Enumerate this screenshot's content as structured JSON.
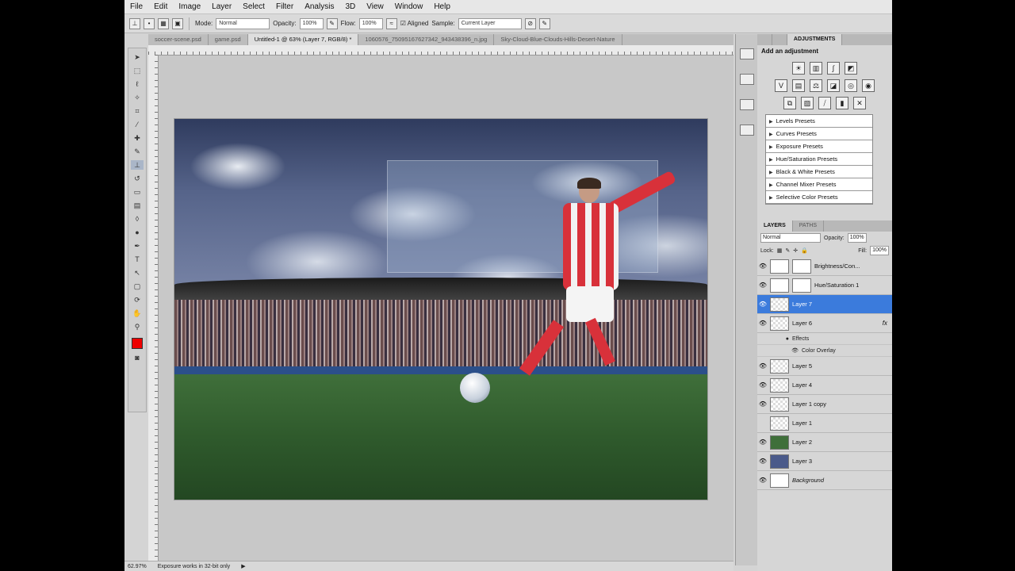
{
  "menu": [
    "File",
    "Edit",
    "Image",
    "Layer",
    "Select",
    "Filter",
    "Analysis",
    "3D",
    "View",
    "Window",
    "Help"
  ],
  "options": {
    "mode_label": "Mode:",
    "mode_value": "Normal",
    "opacity_label": "Opacity:",
    "opacity_value": "100%",
    "flow_label": "Flow:",
    "flow_value": "100%",
    "aligned_label": "Aligned",
    "sample_label": "Sample:",
    "sample_value": "Current Layer"
  },
  "tabs": [
    "soccer-scene.psd",
    "game.psd",
    "Untitled-1 @ 63% (Layer 7, RGB/8) *",
    "1060576_75095167627342_943438396_n.jpg",
    "Sky-Cloud-Blue-Clouds-Hills-Desert-Nature"
  ],
  "status": {
    "zoom": "62.97%",
    "message": "Exposure works in 32-bit only"
  },
  "adjustments": {
    "tabs": [
      "ADJUSTMENTS"
    ],
    "title": "Add an adjustment",
    "presets": [
      "Levels Presets",
      "Curves Presets",
      "Exposure Presets",
      "Hue/Saturation Presets",
      "Black & White Presets",
      "Channel Mixer Presets",
      "Selective Color Presets"
    ]
  },
  "layers": {
    "tabs": [
      "LAYERS",
      "PATHS"
    ],
    "blend": "Normal",
    "opacity_label": "Opacity:",
    "opacity": "100%",
    "lock_label": "Lock:",
    "fill_label": "Fill:",
    "fill": "100%",
    "items": [
      {
        "name": "Brightness/Con..."
      },
      {
        "name": "Hue/Saturation 1"
      },
      {
        "name": "Layer 7"
      },
      {
        "name": "Layer 6"
      },
      {
        "name": "Effects"
      },
      {
        "name": "Color Overlay"
      },
      {
        "name": "Layer 5"
      },
      {
        "name": "Layer 4"
      },
      {
        "name": "Layer 1 copy"
      },
      {
        "name": "Layer 1"
      },
      {
        "name": "Layer 2"
      },
      {
        "name": "Layer 3"
      },
      {
        "name": "Background"
      }
    ]
  },
  "colors": {
    "foreground": "#e00000",
    "selection": "#3b7bdc"
  }
}
